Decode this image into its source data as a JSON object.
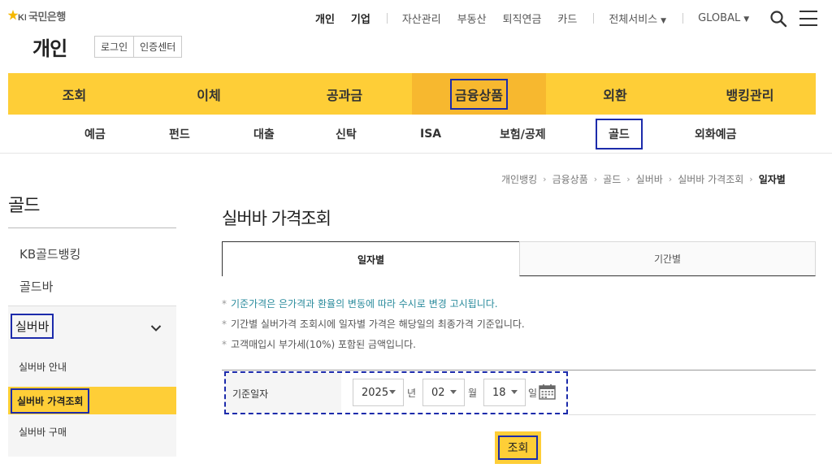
{
  "header": {
    "logo_text": "국민은행",
    "logo_prefix": "KB",
    "page_title": "개인",
    "login_label": "로그인",
    "cert_label": "인증센터",
    "top_nav": {
      "personal": "개인",
      "corporate": "기업",
      "asset": "자산관리",
      "realestate": "부동산",
      "pension": "퇴직연금",
      "card": "카드",
      "all_services": "전체서비스",
      "global": "GLOBAL"
    }
  },
  "gnb": {
    "tabs": [
      {
        "label": "조회"
      },
      {
        "label": "이체"
      },
      {
        "label": "공과금"
      },
      {
        "label": "금융상품"
      },
      {
        "label": "외환"
      },
      {
        "label": "뱅킹관리"
      }
    ]
  },
  "subnav": {
    "items": [
      {
        "label": "예금"
      },
      {
        "label": "펀드"
      },
      {
        "label": "대출"
      },
      {
        "label": "신탁"
      },
      {
        "label": "ISA"
      },
      {
        "label": "보험/공제"
      },
      {
        "label": "골드"
      },
      {
        "label": "외화예금"
      }
    ]
  },
  "sidebar": {
    "title": "골드",
    "items": [
      {
        "label": "KB골드뱅킹"
      },
      {
        "label": "골드바"
      },
      {
        "label": "실버바"
      }
    ],
    "sub_items": [
      {
        "label": "실버바 안내"
      },
      {
        "label": "실버바 가격조회"
      },
      {
        "label": "실버바 구매"
      }
    ]
  },
  "breadcrumb": {
    "items": [
      "개인뱅킹",
      "금융상품",
      "골드",
      "실버바",
      "실버바 가격조회",
      "일자별"
    ]
  },
  "content": {
    "title": "실버바 가격조회",
    "tabs": [
      {
        "label": "일자별"
      },
      {
        "label": "기간별"
      }
    ],
    "notes": [
      "기준가격은 은가격과 환율의 변동에 따라 수시로 변경 고시됩니다.",
      "기간별 실버가격 조회시에 일자별 가격은 해당일의 최종가격 기준입니다.",
      "고객매입시 부가세(10%) 포함된 금액입니다."
    ],
    "form": {
      "label": "기준일자",
      "year": "2025",
      "year_unit": "년",
      "month": "02",
      "month_unit": "월",
      "day": "18",
      "day_unit": "일"
    },
    "submit_label": "조회"
  },
  "colors": {
    "brand_yellow": "#fece37",
    "brand_yellow_dark": "#f7b82f",
    "highlight_blue": "#1c2bab",
    "note_teal": "#2a8b9c"
  }
}
